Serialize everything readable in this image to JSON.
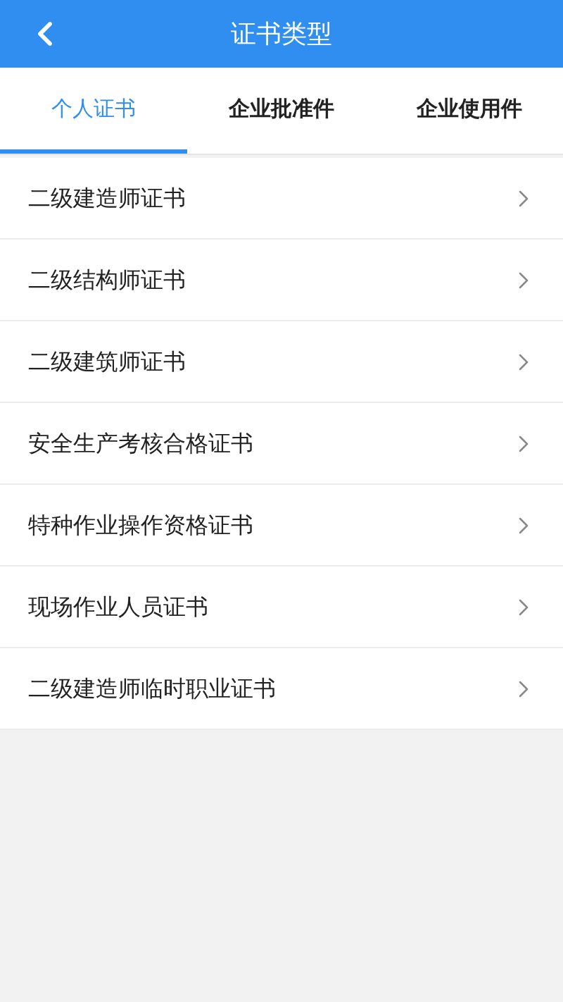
{
  "header": {
    "title": "证书类型"
  },
  "tabs": [
    {
      "label": "个人证书",
      "selected": true
    },
    {
      "label": "企业批准件",
      "selected": false
    },
    {
      "label": "企业使用件",
      "selected": false
    }
  ],
  "items": [
    {
      "label": "二级建造师证书"
    },
    {
      "label": "二级结构师证书"
    },
    {
      "label": "二级建筑师证书"
    },
    {
      "label": "安全生产考核合格证书"
    },
    {
      "label": "特种作业操作资格证书"
    },
    {
      "label": "现场作业人员证书"
    },
    {
      "label": "二级建造师临时职业证书"
    }
  ]
}
